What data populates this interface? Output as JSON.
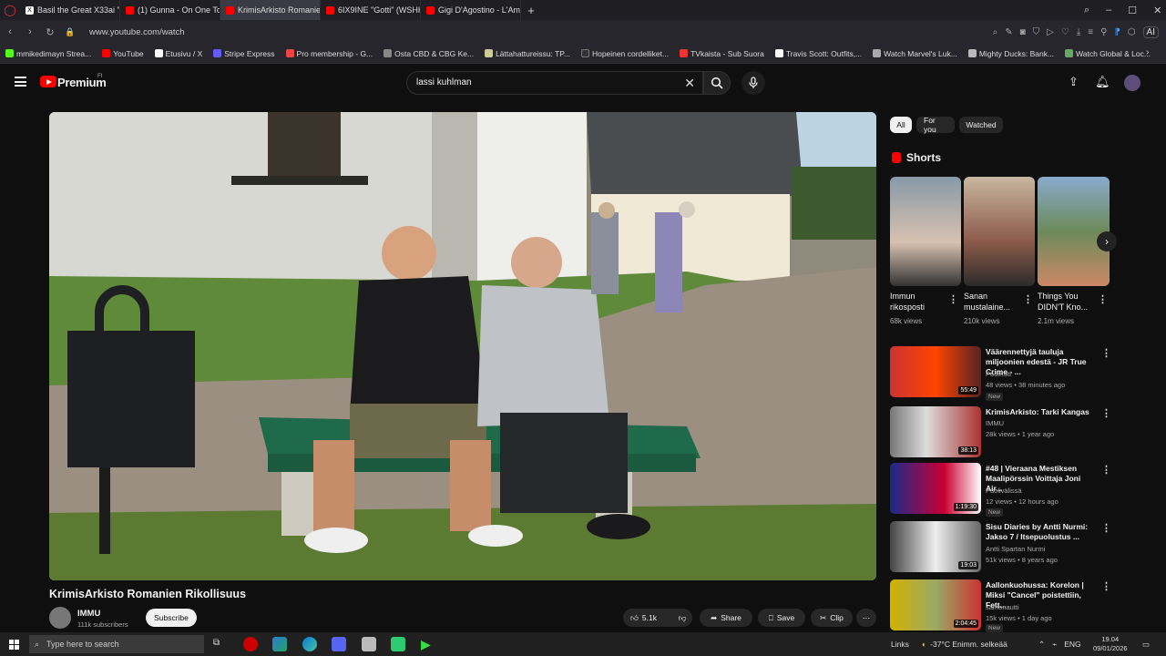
{
  "browser": {
    "tabs": [
      {
        "label": "Basil the Great X33ai \"You",
        "color": "#ffffff"
      },
      {
        "label": "(1) Gunna - On One Tonig",
        "color": "#ff0000"
      },
      {
        "label": "KrimisArkisto Romanien R",
        "color": "#ff0000"
      },
      {
        "label": "6IX9INE \"Gotti\" (WSHH E",
        "color": "#ff0000"
      },
      {
        "label": "Gigi D'Agostino - L'Amou",
        "color": "#ff0000"
      }
    ],
    "url": "www.youtube.com/watch",
    "bookmarks": [
      "mmikedimayn Strea...",
      "YouTube",
      "Etusivu / X",
      "Stripe Express",
      "Pro membership - G...",
      "Osta CBD & CBG Ke...",
      "Lättahattureissu: TP...",
      "Hopeinen cordelliket...",
      "TVkaista - Sub Suora",
      "Travis Scott: Outfits,...",
      "Watch Marvel's Luk...",
      "Mighty Ducks: Bank...",
      "Watch Global & Loc..."
    ],
    "ai_label": "AI"
  },
  "youtube": {
    "logo_text": "Premium",
    "region": "FI",
    "search_value": "lassi kuhlman"
  },
  "video": {
    "title": "KrimisArkisto Romanien Rikollisuus",
    "channel": "IMMU",
    "subscribers": "111k subscribers",
    "subscribe_label": "Subscribe",
    "likes": "5.1k",
    "share_label": "Share",
    "save_label": "Save",
    "clip_label": "Clip"
  },
  "filters": {
    "all": "All",
    "for_you": "For you",
    "watched": "Watched"
  },
  "shorts": {
    "heading": "Shorts",
    "items": [
      {
        "title": "Immun rikosposti",
        "views": "68k views"
      },
      {
        "title": "Sanan mustalaine...",
        "views": "210k views"
      },
      {
        "title": "Things You DIDN'T Kno...",
        "views": "2.1m views"
      }
    ]
  },
  "recommendations": [
    {
      "title": "Väärennettyjä tauluja miljoonien edestä - JR True Crime - ...",
      "channel": "PodiKoti",
      "meta": "48 views • 38 minutes ago",
      "duration": "55:49",
      "is_new": true,
      "new_label": "New"
    },
    {
      "title": "KrimisArkisto: Tarki Kangas",
      "channel": "IMMU",
      "meta": "28k views • 1 year ago",
      "duration": "38:13",
      "is_new": false
    },
    {
      "title": "#48 | Vieraana Mestiksen Maalipörssin Voittaja Joni Air...",
      "channel": "Puolivälissä",
      "meta": "12 views • 12 hours ago",
      "duration": "1:19:30",
      "is_new": true,
      "new_label": "New"
    },
    {
      "title": "Sisu Diaries by Antti Nurmi: Jakso 7 / Itsepuolustus ...",
      "channel": "Antti Spartan Nurmi",
      "meta": "51k views • 8 years ago",
      "duration": "19:03",
      "is_new": false
    },
    {
      "title": "Aallonkuohussa: Korelon | Miksi \"Cancel\" poistettiin, Fett...",
      "channel": "samonautti",
      "meta": "15k views • 1 day ago",
      "duration": "2:04:45",
      "is_new": true,
      "new_label": "New"
    }
  ],
  "taskbar": {
    "search_placeholder": "Type here to search",
    "links": "Links",
    "weather": "-37°C  Enimm. selkeää",
    "lang": "ENG",
    "time": "19.04",
    "date": "09/01/2026"
  }
}
